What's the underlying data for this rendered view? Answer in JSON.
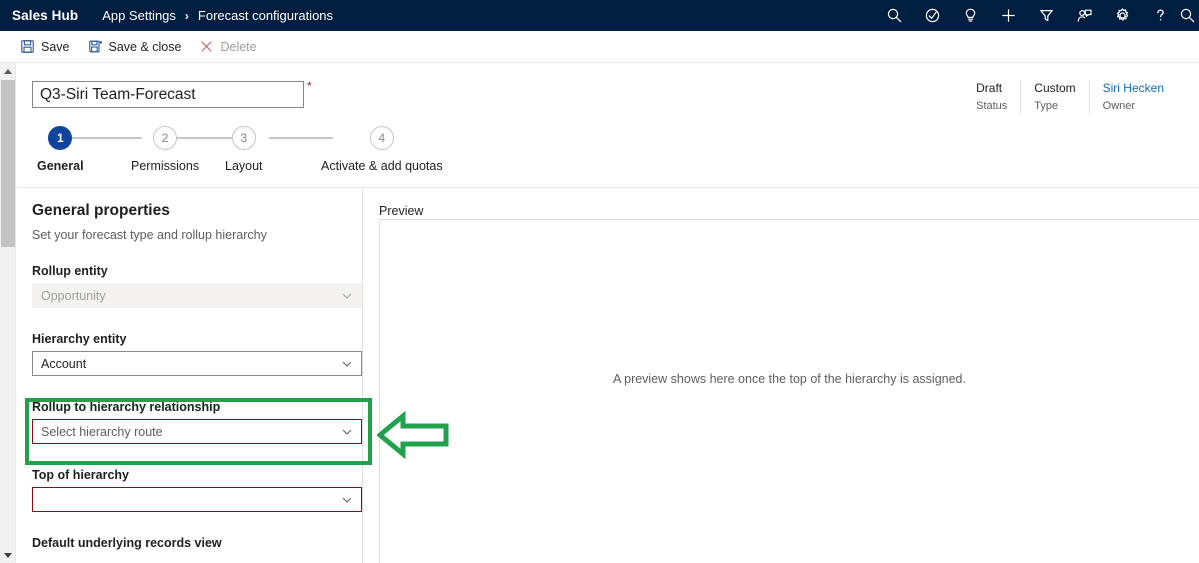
{
  "topnav": {
    "app_name": "Sales Hub",
    "breadcrumb": [
      {
        "label": "App Settings",
        "name": "breadcrumb-app-settings"
      },
      {
        "label": "Forecast configurations",
        "name": "breadcrumb-forecast-configurations"
      }
    ],
    "separator": "›",
    "icons": [
      {
        "name": "search-icon",
        "title": "Search"
      },
      {
        "name": "diagnostics-icon",
        "title": "Diagnostics"
      },
      {
        "name": "lightbulb-icon",
        "title": "Insights"
      },
      {
        "name": "plus-icon",
        "title": "New"
      },
      {
        "name": "filter-icon",
        "title": "Filter"
      },
      {
        "name": "assistant-icon",
        "title": "Assistant"
      },
      {
        "name": "gear-icon",
        "title": "Settings"
      },
      {
        "name": "question-icon",
        "title": "Help"
      },
      {
        "name": "user-search-icon",
        "title": "Search"
      }
    ]
  },
  "commandbar": {
    "save_label": "Save",
    "save_close_label": "Save & close",
    "delete_label": "Delete"
  },
  "header": {
    "title_value": "Q3-Siri Team-Forecast",
    "required_marker": "*",
    "meta": [
      {
        "value": "Draft",
        "label": "Status",
        "link": false
      },
      {
        "value": "Custom",
        "label": "Type",
        "link": false
      },
      {
        "value": "Siri Hecken",
        "label": "Owner",
        "link": true
      }
    ]
  },
  "stepper": {
    "steps": [
      {
        "number": "1",
        "label": "General",
        "active": true
      },
      {
        "number": "2",
        "label": "Permissions",
        "active": false
      },
      {
        "number": "3",
        "label": "Layout",
        "active": false
      },
      {
        "number": "4",
        "label": "Activate & add quotas",
        "active": false
      }
    ]
  },
  "section": {
    "title": "General properties",
    "subtitle": "Set your forecast type and rollup hierarchy"
  },
  "fields": {
    "rollup_entity": {
      "label": "Rollup entity",
      "value": "Opportunity",
      "state": "disabled"
    },
    "hierarchy_entity": {
      "label": "Hierarchy entity",
      "value": "Account",
      "state": "normal"
    },
    "rollup_relationship": {
      "label": "Rollup to hierarchy relationship",
      "placeholder": "Select hierarchy route",
      "value": "",
      "state": "error"
    },
    "top_of_hierarchy": {
      "label": "Top of hierarchy",
      "placeholder": "",
      "value": "",
      "state": "error"
    },
    "default_records_view": {
      "label": "Default underlying records view"
    }
  },
  "preview": {
    "label": "Preview",
    "empty_message": "A preview shows here once the top of the hierarchy is assigned."
  },
  "annotation": {
    "color": "#21a14b",
    "shape": "left-arrow",
    "target": "rollup_relationship"
  },
  "colors": {
    "nav_background": "#001e3f",
    "accent_blue": "#11459c",
    "link_blue": "#0f6cbd",
    "error_red": "#8b0a18",
    "required_red": "#a4262c",
    "annotation_green": "#21a14b"
  }
}
